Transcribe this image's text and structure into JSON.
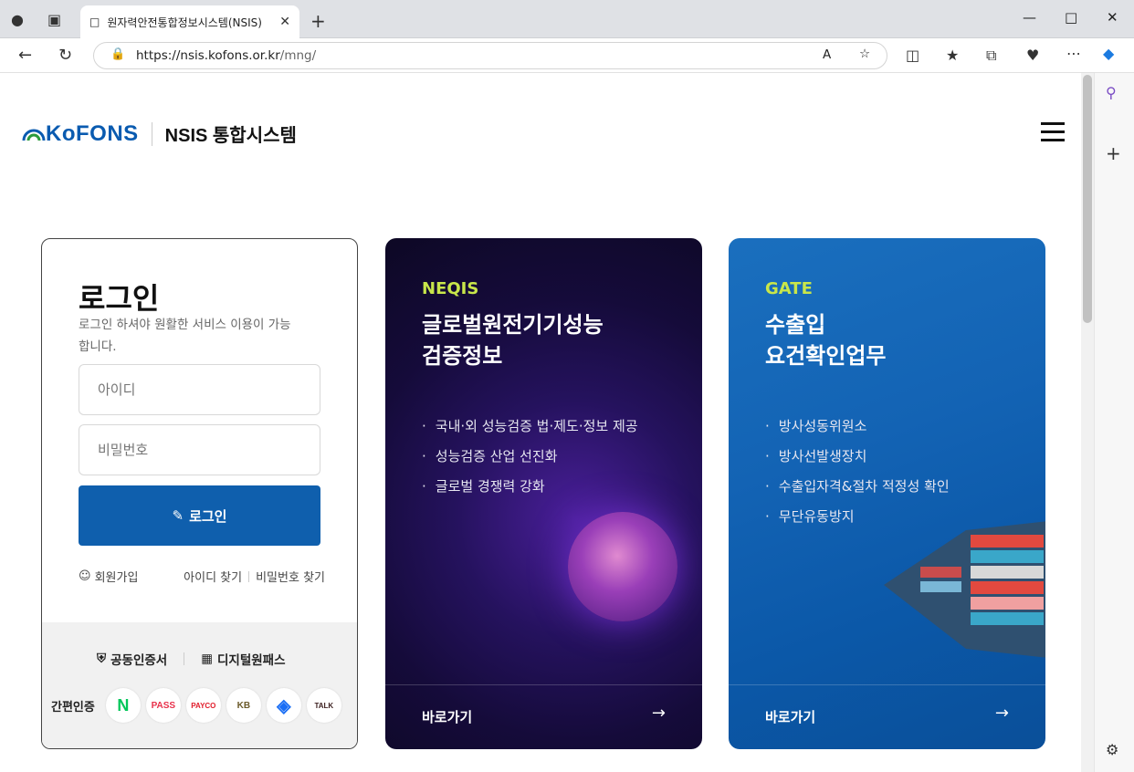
{
  "browser": {
    "tab_title": "원자력안전통합정보시스템(NSIS)",
    "url_host": "https://nsis.kofons.or.kr",
    "url_path": "/mng/"
  },
  "header": {
    "logo_text": "KoFONS",
    "system_title": "NSIS 통합시스템"
  },
  "login": {
    "title": "로그인",
    "description": "로그인 하셔야 원활한 서비스 이용이 가능합니다.",
    "id_placeholder": "아이디",
    "pw_placeholder": "비밀번호",
    "button": "로그인",
    "signup": "회원가입",
    "find_id": "아이디 찾기",
    "find_pw": "비밀번호 찾기",
    "cert_public": "공동인증서",
    "cert_digital": "디지털원패스",
    "simple_auth_label": "간편인증",
    "simple_auth": [
      "N",
      "PASS",
      "PAYCO",
      "KB",
      "toss",
      "TALK"
    ]
  },
  "cards": [
    {
      "tag": "NEQIS",
      "title_line1": "글로벌원전기기성능",
      "title_line2": "검증정보",
      "items": [
        "국내·외 성능검증 법·제도·정보 제공",
        "성능검증 산업 선진화",
        "글로벌 경쟁력 강화"
      ],
      "link": "바로가기"
    },
    {
      "tag": "GATE",
      "title_line1": "수출입",
      "title_line2": "요건확인업무",
      "items": [
        "방사성동위원소",
        "방사선발생장치",
        "수출입자격&절차 적정성 확인",
        "무단유동방지"
      ],
      "link": "바로가기"
    }
  ],
  "colors": {
    "brand": "#0f5fad",
    "accent": "#c8e64a"
  }
}
